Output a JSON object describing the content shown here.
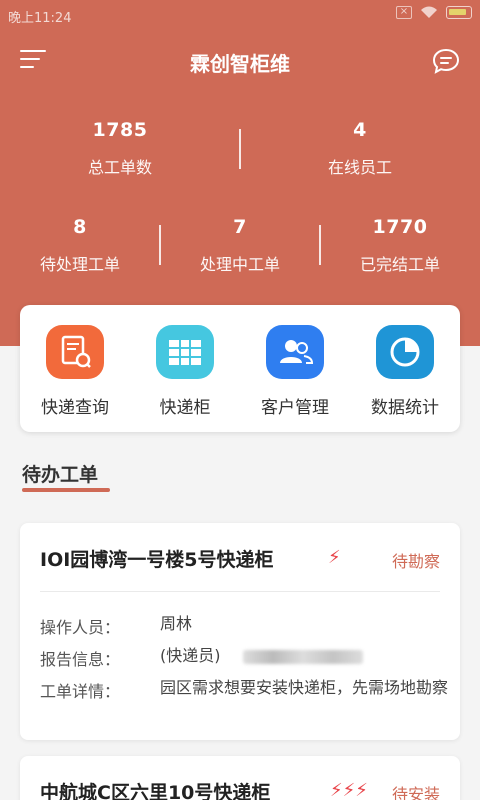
{
  "status_bar": {
    "time": "晚上11:24"
  },
  "header": {
    "title": "霖创智柜维"
  },
  "stats_top": [
    {
      "value": "1785",
      "label": "总工单数"
    },
    {
      "value": "4",
      "label": "在线员工"
    }
  ],
  "stats_bottom": [
    {
      "value": "8",
      "label": "待处理工单"
    },
    {
      "value": "7",
      "label": "处理中工单"
    },
    {
      "value": "1770",
      "label": "已完结工单"
    }
  ],
  "quick_actions": [
    {
      "label": "快递查询",
      "icon": "package-search-icon",
      "color": "#f26a3b"
    },
    {
      "label": "快递柜",
      "icon": "locker-grid-icon",
      "color": "#45c7e0"
    },
    {
      "label": "客户管理",
      "icon": "users-icon",
      "color": "#2f7ef0"
    },
    {
      "label": "数据统计",
      "icon": "pie-chart-icon",
      "color": "#1f95d6"
    }
  ],
  "section": {
    "title": "待办工单"
  },
  "orders": [
    {
      "title": "IOI园博湾一号楼5号快递柜",
      "bolts": "⚡",
      "status": "待勘察",
      "operator_label": "操作人员：",
      "operator": "周林",
      "report_label": "报告信息：",
      "report": "(快递员)",
      "detail_label": "工单详情：",
      "detail": "园区需求想要安装快递柜，先需场地勘察"
    },
    {
      "title": "中航城C区六里10号快递柜",
      "bolts": "⚡⚡⚡",
      "status": "待安装"
    }
  ],
  "colors": {
    "accent": "#cf6a56",
    "urgent": "#e8454b"
  }
}
